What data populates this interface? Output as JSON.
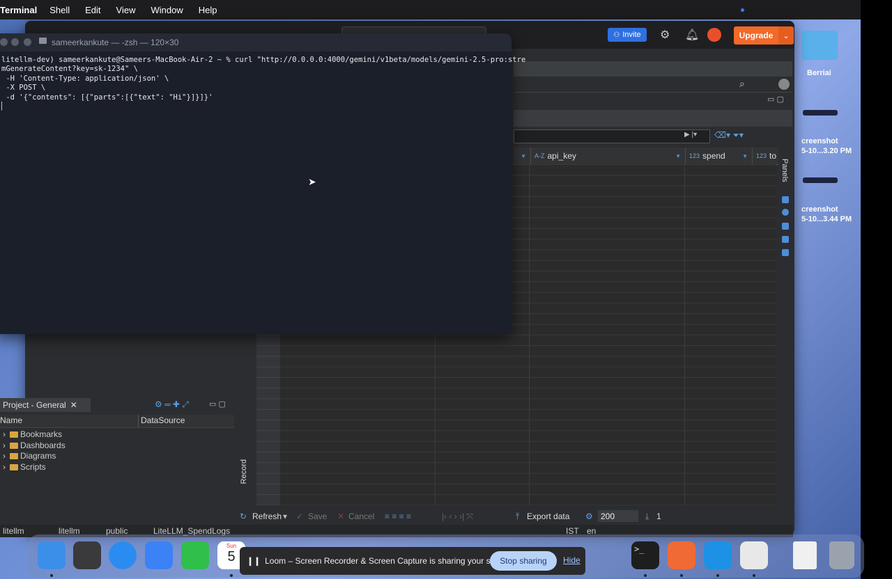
{
  "menubar": {
    "app": "Terminal",
    "items": [
      "Shell",
      "Edit",
      "View",
      "Window",
      "Help"
    ]
  },
  "desktop": {
    "folder_label": "Berriai",
    "screenshot1_line1": "creenshot",
    "screenshot1_line2": "5-10...3.20 PM",
    "screenshot2_line1": "creenshot",
    "screenshot2_line2": "5-10...3.44 PM"
  },
  "dbeaver": {
    "invite_label": "Invite",
    "upgrade_label": "Upgrade",
    "columns": [
      {
        "type": "A-Z",
        "name": "api_key"
      },
      {
        "type": "123",
        "name": "spend"
      },
      {
        "type": "123",
        "name": "to"
      }
    ],
    "panels_label": "Panels",
    "record_label": "Record",
    "project": {
      "tab": "Project - General",
      "col_name": "Name",
      "col_datasource": "DataSource",
      "items": [
        "Bookmarks",
        "Dashboards",
        "Diagrams",
        "Scripts"
      ]
    },
    "toolbar": {
      "refresh": "Refresh",
      "save": "Save",
      "cancel": "Cancel",
      "export": "Export data",
      "limit": "200",
      "count": "1"
    },
    "statusbar": {
      "crumbs": [
        "litellm",
        "litellm",
        "public",
        "LiteLLM_SpendLogs"
      ],
      "tz": "IST",
      "lang": "en"
    }
  },
  "terminal": {
    "title": "sameerkankute — -zsh — 120×30",
    "lines": [
      "litellm-dev) sameerkankute@Sameers-MacBook-Air-2 ~ % curl \"http://0.0.0.0:4000/gemini/v1beta/models/gemini-2.5-pro:stre",
      "mGenerateContent?key=sk-1234\" \\",
      " -H 'Content-Type: application/json' \\",
      " -X POST \\",
      " -d '{\"contents\": [{\"parts\":[{\"text\": \"Hi\"}]}]}'",
      "▏"
    ]
  },
  "dock": {
    "calendar_month": "Sun",
    "calendar_day": "5"
  },
  "loom": {
    "message": "Loom – Screen Recorder & Screen Capture is sharing your screen.",
    "stop": "Stop sharing",
    "hide": "Hide"
  }
}
